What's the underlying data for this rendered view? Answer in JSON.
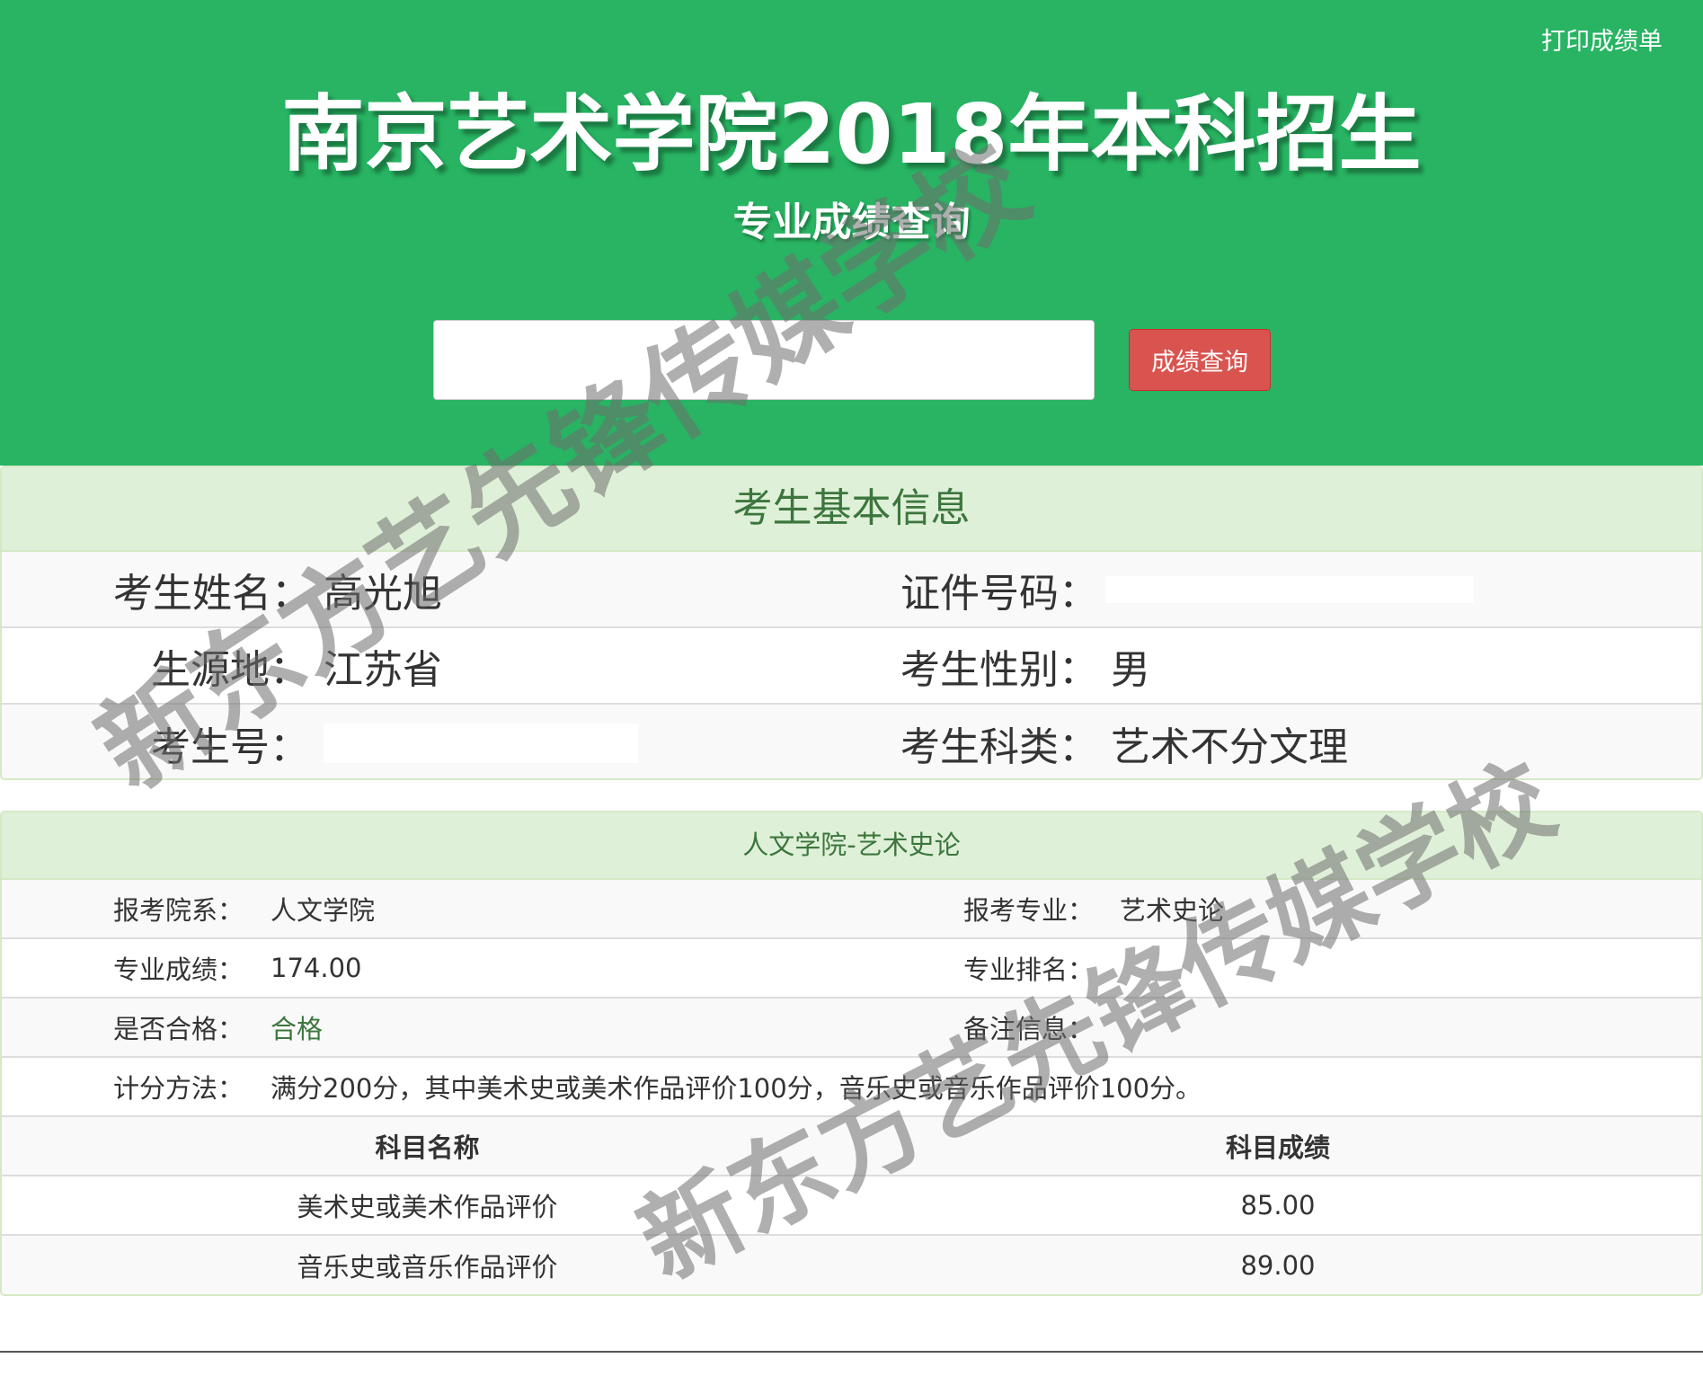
{
  "header": {
    "print_label": "打印成绩单",
    "title": "南京艺术学院2018年本科招生",
    "subtitle": "专业成绩查询",
    "search_value": "",
    "query_button": "成绩查询",
    "background_color": "#28b463"
  },
  "basic_info": {
    "heading": "考生基本信息",
    "rows": [
      {
        "left_label": "考生姓名：",
        "left_value": "高光旭",
        "right_label": "证件号码：",
        "right_value": ""
      },
      {
        "left_label": "生源地：",
        "left_value": "江苏省",
        "right_label": "考生性别：",
        "right_value": "男"
      },
      {
        "left_label": "考生号：",
        "left_value": "",
        "right_label": "考生科类：",
        "right_value": "艺术不分文理"
      }
    ]
  },
  "score_info": {
    "heading": "人文学院-艺术史论",
    "rows": [
      {
        "left_label": "报考院系：",
        "left_value": "人文学院",
        "right_label": "报考专业：",
        "right_value": "艺术史论"
      },
      {
        "left_label": "专业成绩：",
        "left_value": "174.00",
        "right_label": "专业排名：",
        "right_value": ""
      },
      {
        "left_label": "是否合格：",
        "left_value": "合格",
        "right_label": "备注信息：",
        "right_value": ""
      }
    ],
    "method_label": "计分方法：",
    "method_value": "满分200分，其中美术史或美术作品评价100分，音乐史或音乐作品评价100分。",
    "table": {
      "headers": [
        "科目名称",
        "科目成绩"
      ],
      "rows": [
        [
          "美术史或美术作品评价",
          "85.00"
        ],
        [
          "音乐史或音乐作品评价",
          "89.00"
        ]
      ]
    },
    "pass_color": "#3c763d"
  },
  "watermark": {
    "text1": "新东方艺先锋传媒学校",
    "text2": "新东方艺先锋传媒学校"
  }
}
